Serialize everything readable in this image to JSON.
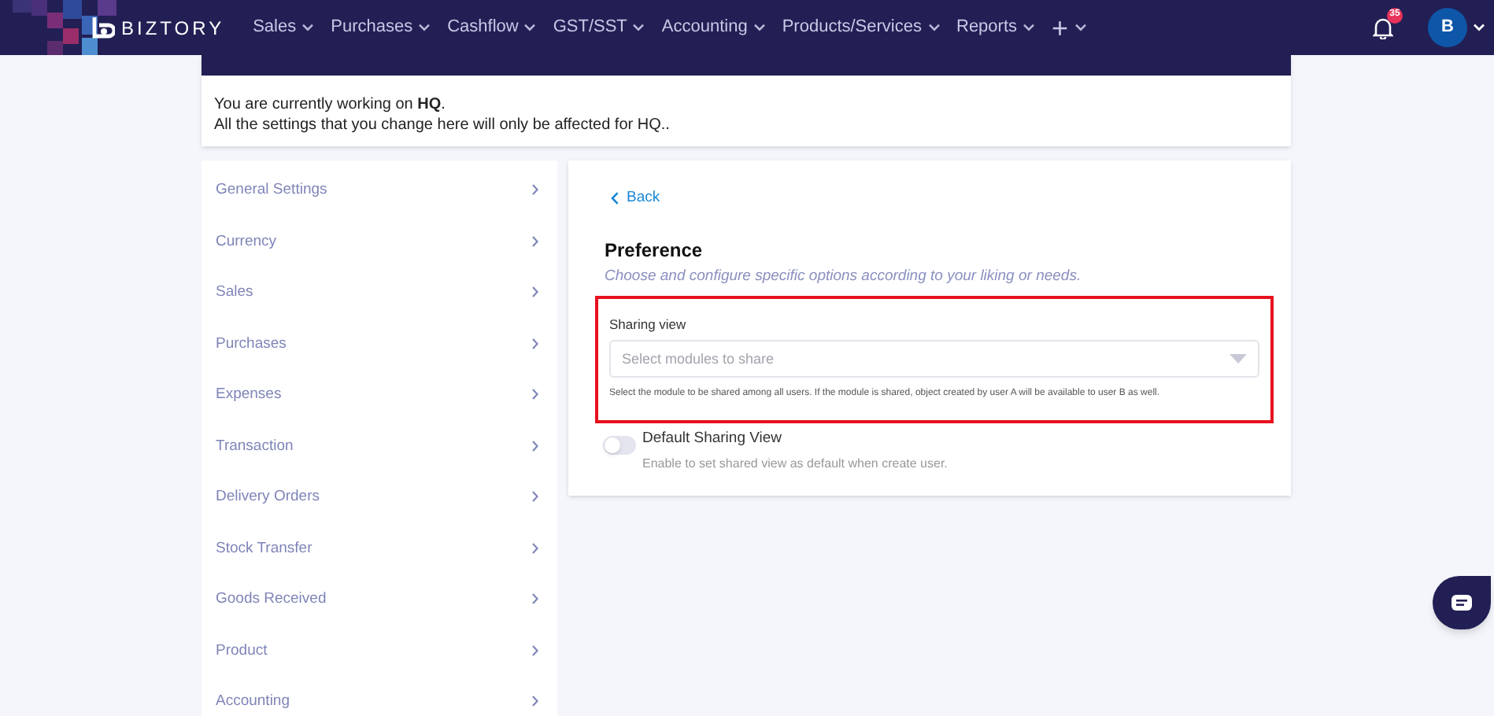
{
  "navbar": {
    "brand": "BIZTORY",
    "menu": [
      {
        "label": "Sales"
      },
      {
        "label": "Purchases"
      },
      {
        "label": "Cashflow"
      },
      {
        "label": "GST/SST"
      },
      {
        "label": "Accounting"
      },
      {
        "label": "Products/Services"
      },
      {
        "label": "Reports"
      },
      {
        "label": "+"
      }
    ],
    "notifications": "35",
    "avatar": "B"
  },
  "notice": {
    "line_1": "You are currently working on **HQ**.",
    "line_2": "All the settings that you change here will only be affected for HQ.."
  },
  "sidebar": {
    "items": [
      {
        "label": "General Settings"
      },
      {
        "label": "Currency"
      },
      {
        "label": "Sales"
      },
      {
        "label": "Purchases"
      },
      {
        "label": "Expenses"
      },
      {
        "label": "Transaction"
      },
      {
        "label": "Delivery Orders"
      },
      {
        "label": "Stock Transfer"
      },
      {
        "label": "Goods Received"
      },
      {
        "label": "Product"
      },
      {
        "label": "Accounting"
      }
    ]
  },
  "panel": {
    "back": "Back",
    "title": "Preference",
    "subtitle": "Choose and configure specific options according to your liking or needs.",
    "sharing_view": {
      "label": "Sharing view",
      "placeholder": "Select modules to share",
      "help": "Select the module to be shared among all users. If the module is shared, object created by user A will be available to user B as well."
    },
    "default_sharing": {
      "label": "Default Sharing View",
      "description": "Enable to set shared view as default when create user.",
      "on": false
    }
  }
}
